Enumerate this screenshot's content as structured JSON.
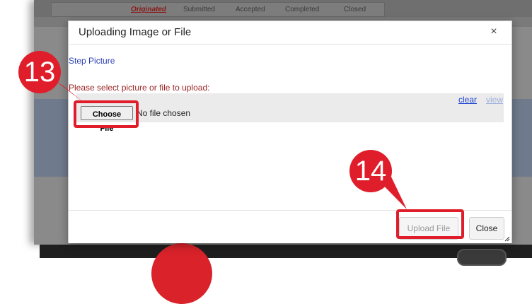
{
  "status_bar": {
    "items": [
      "Originated",
      "Submitted",
      "Accepted",
      "Completed",
      "Closed"
    ],
    "active_index": 0
  },
  "dialog": {
    "title": "Uploading Image or File",
    "close_symbol": "×",
    "step_picture": "Step Picture",
    "select_label": "Please select picture or file to upload:",
    "clear_link": "clear",
    "view_link": "view",
    "choose_file_label": "Choose File",
    "no_file_text": "No file chosen",
    "upload_button": "Upload File",
    "close_button": "Close"
  },
  "annotations": {
    "step_13": "13",
    "step_14": "14",
    "highlight_color": "#e01e2b"
  },
  "colors": {
    "label_red": "#9b2323",
    "link_blue": "#1a3fd0",
    "overlay_gray": "#8a8a8a"
  }
}
